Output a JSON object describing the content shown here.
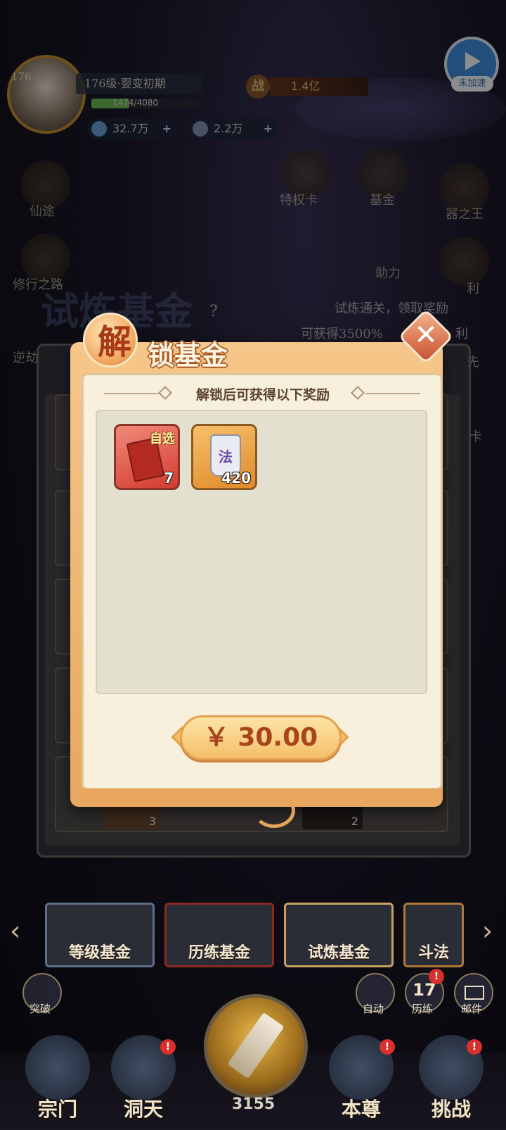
{
  "topbar": {
    "avatar_level": "176",
    "level_text": "176级·婴变初期",
    "xp_text": "1474/4080",
    "xp_fraction": 0.361,
    "power_icon": "战",
    "power_value": "1.4亿",
    "currency1": "32.7万",
    "currency2": "2.2万",
    "plus": "+"
  },
  "speed": {
    "label": "未加速"
  },
  "side_left": [
    "仙途",
    "修行之路",
    "逆劫"
  ],
  "side_top": [
    "特权卡",
    "基金"
  ],
  "side_right": [
    "器之王",
    "助力",
    "利",
    "先",
    "卡"
  ],
  "background": {
    "title": "试炼基金",
    "line1": "试炼通关，领取奖励",
    "line2": "可获得3500%",
    "line2_suffix": "利",
    "help": "?"
  },
  "dialog": {
    "title_first": "解",
    "title_rest": "锁基金",
    "close": "✕",
    "subtitle": "解锁后可获得以下奖励",
    "rewards": [
      {
        "name": "自选",
        "count": "7"
      },
      {
        "name": "法",
        "count": "420"
      }
    ],
    "price": "￥ 30.00"
  },
  "under_items": [
    "3",
    "2"
  ],
  "fund_tabs": [
    "等级基金",
    "历练基金",
    "试炼基金",
    "斗法"
  ],
  "bottom_small": {
    "left": "突破",
    "auto": "自动",
    "trial": "历练",
    "trial_count": "17",
    "mail": "邮件"
  },
  "nav": [
    {
      "label": "宗门"
    },
    {
      "label": "洞天"
    },
    {
      "label": "本尊"
    },
    {
      "label": "挑战"
    }
  ],
  "orb_count": "3155",
  "colors": {
    "accent_orange": "#e7a760",
    "price_text": "#a8441c",
    "badge_red": "#d8302c"
  }
}
